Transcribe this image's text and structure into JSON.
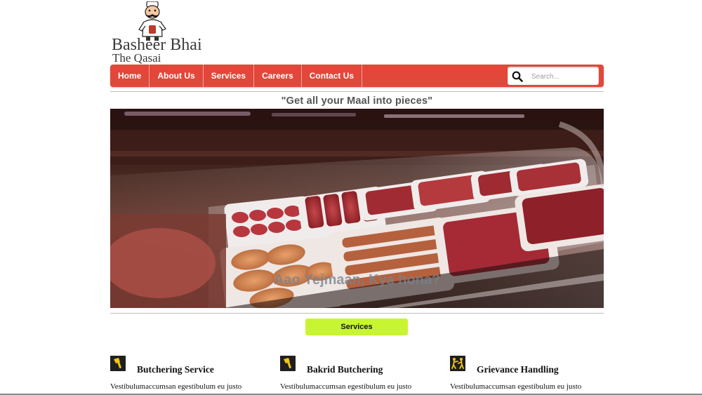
{
  "logo": {
    "title": "Basheer Bhai",
    "subtitle": "The Qasai",
    "icon": "butcher-mascot-icon"
  },
  "nav": {
    "items": [
      {
        "label": "Home"
      },
      {
        "label": "About Us"
      },
      {
        "label": "Services"
      },
      {
        "label": "Careers"
      },
      {
        "label": "Contact Us"
      }
    ],
    "search": {
      "placeholder": "Search...",
      "icon": "search-icon"
    }
  },
  "tagline": "\"Get all your Maal into pieces\"",
  "hero": {
    "caption": "Aao Yejmaan, Kya hona?"
  },
  "services_button": "Services",
  "services": [
    {
      "title": "Butchering Service",
      "text": "Vestibulumaccumsan egestibulum eu justo",
      "icon": "cleaver-icon"
    },
    {
      "title": "Bakrid Butchering",
      "text": "Vestibulumaccumsan egestibulum eu justo",
      "icon": "cleaver-icon"
    },
    {
      "title": "Grievance Handling",
      "text": "Vestibulumaccumsan egestibulum eu justo",
      "icon": "fighting-figures-icon"
    }
  ],
  "colors": {
    "nav": "#e2473a",
    "services_button": "#c8f532",
    "icon_accent": "#f0c419"
  }
}
